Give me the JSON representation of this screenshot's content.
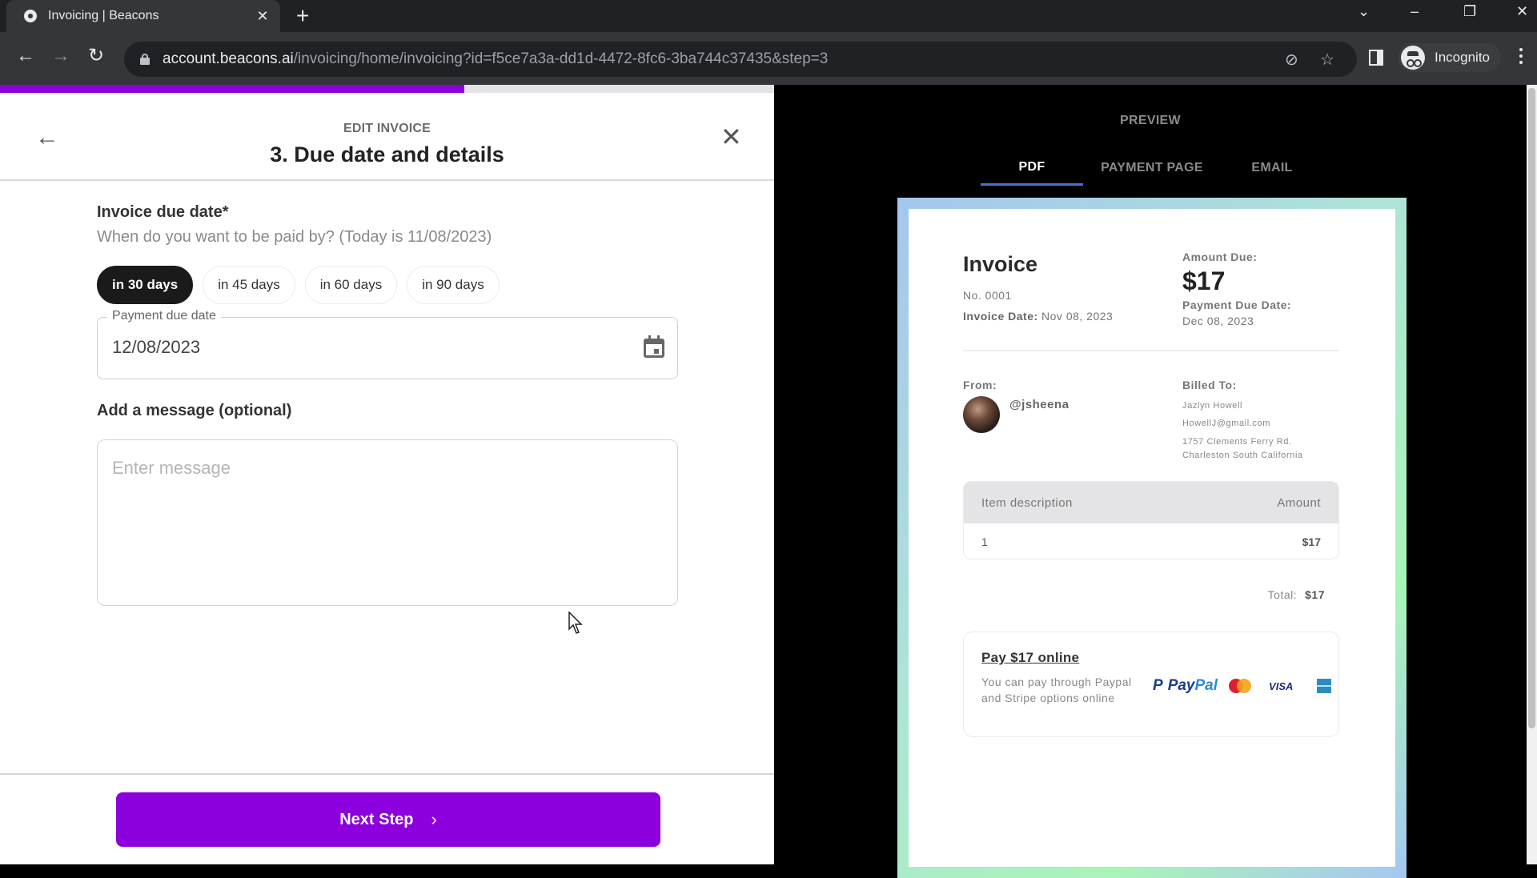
{
  "browser": {
    "tab_title": "Invoicing | Beacons",
    "new_tab_label": "+",
    "url_host": "account.beacons.ai",
    "url_path": "/invoicing/home/invoicing?id=f5ce7a3a-dd1d-4472-8fc6-3ba744c37435&step=3",
    "profile_label": "Incognito"
  },
  "editor": {
    "progress_percent": 60,
    "eyebrow": "EDIT INVOICE",
    "title": "3. Due date and details",
    "due_date_label": "Invoice due date*",
    "due_date_help": "When do you want to be paid by? (Today is 11/08/2023)",
    "due_options": [
      {
        "label": "in 30 days",
        "selected": true
      },
      {
        "label": "in 45 days",
        "selected": false
      },
      {
        "label": "in 60 days",
        "selected": false
      },
      {
        "label": "in 90 days",
        "selected": false
      }
    ],
    "payment_due_label": "Payment due date",
    "payment_due_value": "12/08/2023",
    "message_label": "Add a message (optional)",
    "message_placeholder": "Enter message",
    "message_value": "",
    "next_label": "Next Step"
  },
  "preview": {
    "title": "PREVIEW",
    "tabs": [
      {
        "label": "PDF",
        "active": true
      },
      {
        "label": "PAYMENT PAGE",
        "active": false
      },
      {
        "label": "EMAIL",
        "active": false
      }
    ],
    "invoice": {
      "heading": "Invoice",
      "number": "No. 0001",
      "invoice_date_label": "Invoice Date:",
      "invoice_date_value": "Nov 08, 2023",
      "amount_due_label": "Amount Due:",
      "amount_due_value": "$17",
      "payment_due_label": "Payment Due Date:",
      "payment_due_value": "Dec 08, 2023",
      "from_label": "From:",
      "from_handle": "@jsheena",
      "billed_to_label": "Billed To:",
      "billed_to": {
        "name": "Jazlyn Howell",
        "email": "HowellJ@gmail.com",
        "address_line1": "1757 Clements Ferry Rd.",
        "address_line2": "Charleston South California"
      },
      "items_header": {
        "description": "Item description",
        "amount": "Amount"
      },
      "items": [
        {
          "description": "1",
          "amount": "$17"
        }
      ],
      "total_label": "Total:",
      "total_value": "$17",
      "pay_link": "Pay $17 online",
      "pay_description": "You can pay through Paypal and Stripe options online",
      "payment_methods": [
        "paypal-icon",
        "mastercard-icon",
        "visa-icon",
        "amex-icon"
      ],
      "paypal_text_a": "Pay",
      "paypal_text_b": "Pal",
      "visa_text": "VISA"
    }
  },
  "colors": {
    "accent": "#8c00dd",
    "tab_underline": "#4a6fd6"
  }
}
